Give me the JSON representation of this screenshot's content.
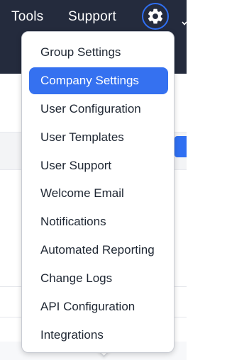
{
  "nav": {
    "tools_label": "Tools",
    "support_label": "Support"
  },
  "icons": {
    "settings": "gear-icon"
  },
  "colors": {
    "topbar": "#242b3d",
    "accent": "#3571f0",
    "menu_text": "#1f2733"
  },
  "settings_menu": {
    "items": [
      {
        "label": "Group Settings",
        "active": false
      },
      {
        "label": "Company Settings",
        "active": true
      },
      {
        "label": "User Configuration",
        "active": false
      },
      {
        "label": "User Templates",
        "active": false
      },
      {
        "label": "User Support",
        "active": false
      },
      {
        "label": "Welcome Email",
        "active": false
      },
      {
        "label": "Notifications",
        "active": false
      },
      {
        "label": "Automated Reporting",
        "active": false
      },
      {
        "label": "Change Logs",
        "active": false
      },
      {
        "label": "API Configuration",
        "active": false
      },
      {
        "label": "Integrations",
        "active": false
      }
    ]
  }
}
